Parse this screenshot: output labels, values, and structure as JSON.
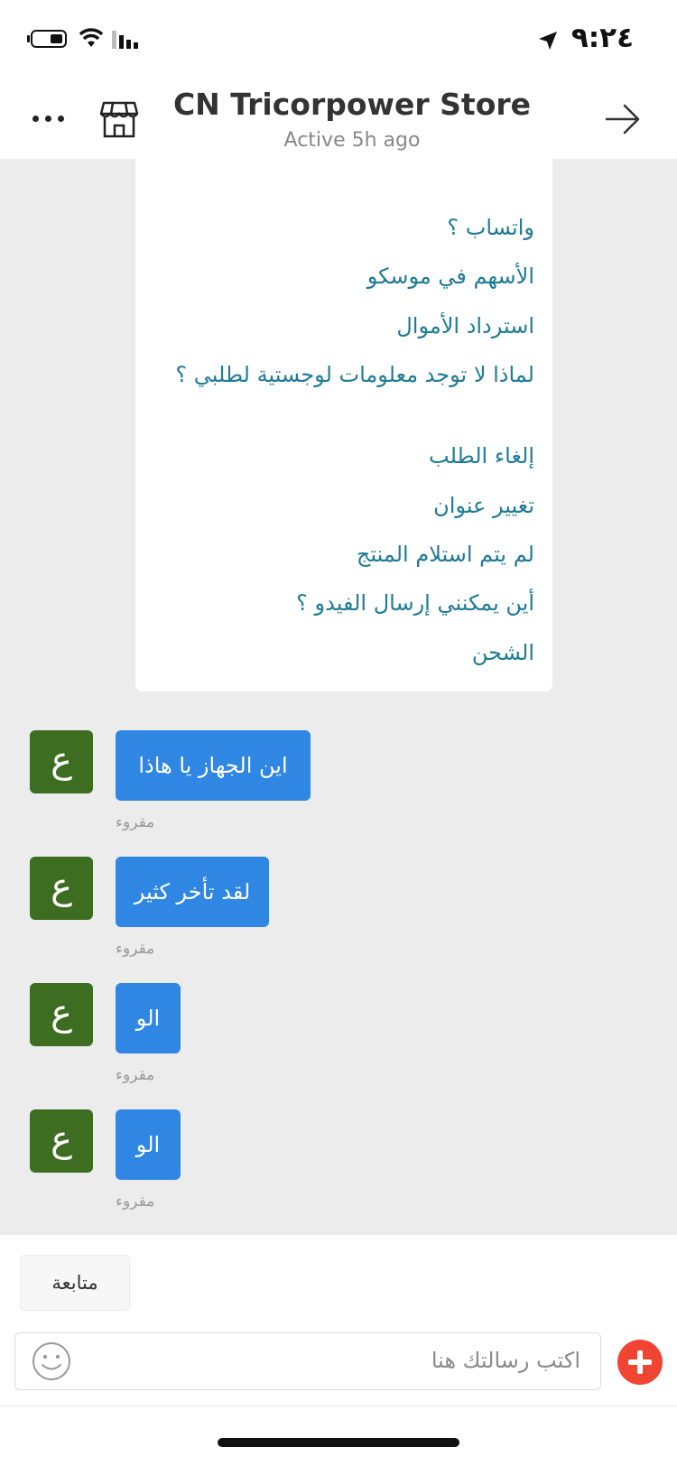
{
  "status_bar": {
    "time": "٩:٢٤"
  },
  "header": {
    "title": "CN Tricorpower Store",
    "subtitle": "Active 5h ago"
  },
  "card": {
    "cut_text": "ـ ـ ـ",
    "links": [
      "واتساب ؟",
      "الأسهم في موسكو",
      "استرداد الأموال",
      "لماذا لا توجد معلومات لوجستية لطلبي ؟",
      "إلغاء الطلب",
      "تغيير عنوان",
      "لم يتم استلام المنتج",
      "أين يمكنني إرسال الفيدو ؟",
      "الشحن"
    ]
  },
  "messages": [
    {
      "avatar": "ع",
      "text": "اين الجهاز يا هاذا",
      "status": "مقروء"
    },
    {
      "avatar": "ع",
      "text": "لقد تأخر كثير",
      "status": "مقروء"
    },
    {
      "avatar": "ع",
      "text": "الو",
      "status": "مقروء"
    },
    {
      "avatar": "ع",
      "text": "الو",
      "status": "مقروء"
    }
  ],
  "bottom": {
    "follow_label": "متابعة",
    "input_placeholder": "اكتب رسالتك هنا"
  },
  "colors": {
    "accent_blue": "#2f86e3",
    "avatar_green": "#3c6d21",
    "link_teal": "#1f7b96",
    "plus_red": "#f14534"
  }
}
